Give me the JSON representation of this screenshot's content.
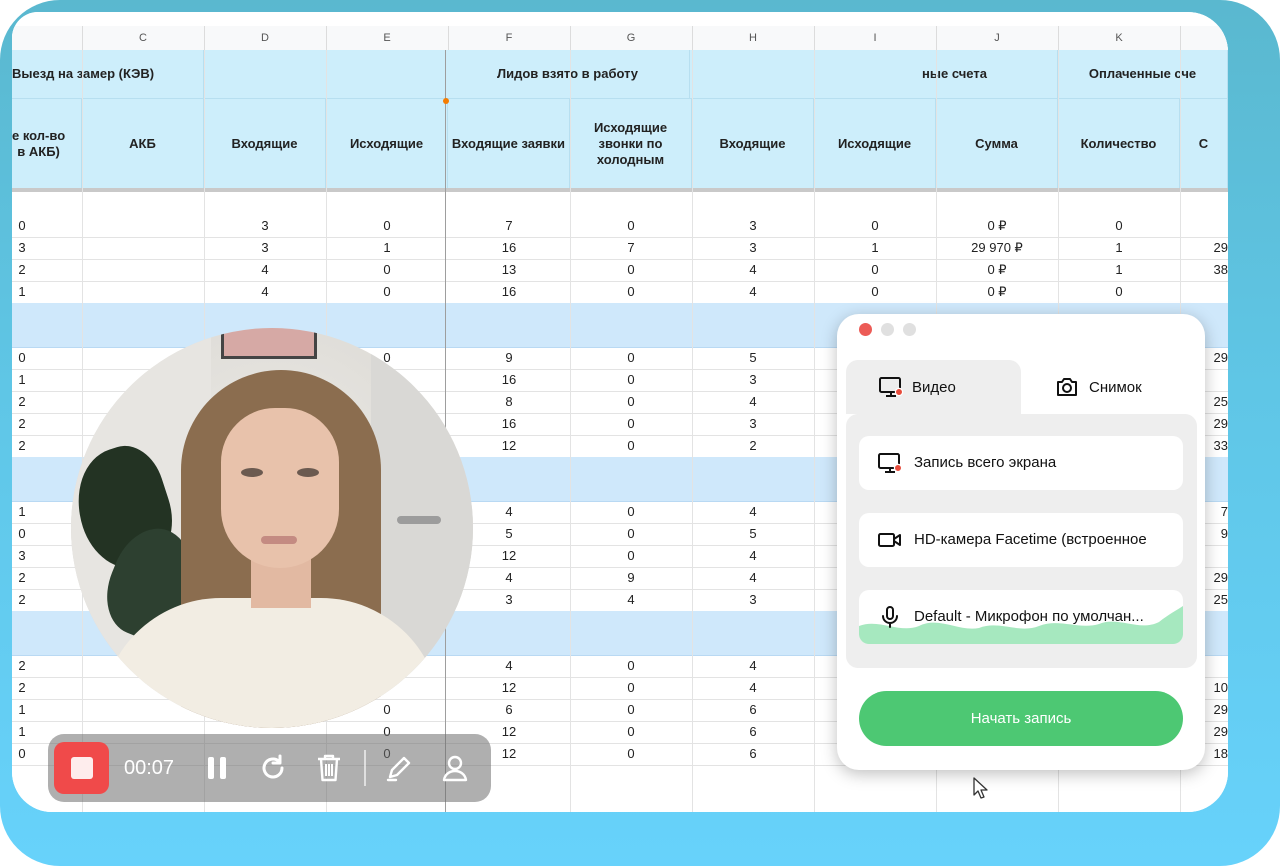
{
  "sheet": {
    "columns": [
      {
        "letter": "C",
        "width": 122
      },
      {
        "letter": "D",
        "width": 122
      },
      {
        "letter": "E",
        "width": 122
      },
      {
        "letter": "F",
        "width": 122
      },
      {
        "letter": "G",
        "width": 122
      },
      {
        "letter": "H",
        "width": 122
      },
      {
        "letter": "I",
        "width": 122
      },
      {
        "letter": "J",
        "width": 122
      },
      {
        "letter": "K",
        "width": 122
      }
    ],
    "group_headers": [
      {
        "label": "Выезд на замер (КЭВ)"
      },
      {
        "label": "Лидов взято в работу"
      },
      {
        "label": "ные счета"
      },
      {
        "label": "Оплаченные сче"
      }
    ],
    "sub_headers": [
      "е кол-во\nв АКБ)",
      "АКБ",
      "Входящие",
      "Исходящие",
      "Входящие заявки",
      "Исходящие звонки по холодным",
      "Входящие",
      "Исходящие",
      "Сумма",
      "Количество",
      "С"
    ],
    "rows": [
      {
        "blue": false,
        "cells": [
          "0",
          "",
          "3",
          "0",
          "7",
          "0",
          "3",
          "0",
          "0 ₽",
          "0",
          ""
        ]
      },
      {
        "blue": false,
        "cells": [
          "3",
          "",
          "3",
          "1",
          "16",
          "7",
          "3",
          "1",
          "29 970 ₽",
          "1",
          "29"
        ]
      },
      {
        "blue": false,
        "cells": [
          "2",
          "",
          "4",
          "0",
          "13",
          "0",
          "4",
          "0",
          "0 ₽",
          "1",
          "38"
        ]
      },
      {
        "blue": false,
        "cells": [
          "1",
          "",
          "4",
          "0",
          "16",
          "0",
          "4",
          "0",
          "0 ₽",
          "0",
          ""
        ]
      },
      {
        "blue": true,
        "cells": []
      },
      {
        "blue": true,
        "cells": []
      },
      {
        "blue": false,
        "cells": [
          "0",
          "",
          "",
          "0",
          "9",
          "0",
          "5",
          "",
          "",
          "",
          "29"
        ]
      },
      {
        "blue": false,
        "cells": [
          "1",
          "",
          "",
          "",
          "16",
          "0",
          "3",
          "",
          "",
          "",
          ""
        ]
      },
      {
        "blue": false,
        "cells": [
          "2",
          "",
          "",
          "",
          "8",
          "0",
          "4",
          "",
          "",
          "",
          "25"
        ]
      },
      {
        "blue": false,
        "cells": [
          "2",
          "",
          "",
          "",
          "16",
          "0",
          "3",
          "",
          "",
          "",
          "29"
        ]
      },
      {
        "blue": false,
        "cells": [
          "2",
          "",
          "",
          "",
          "12",
          "0",
          "2",
          "",
          "",
          "",
          "33"
        ]
      },
      {
        "blue": true,
        "cells": []
      },
      {
        "blue": true,
        "cells": []
      },
      {
        "blue": false,
        "cells": [
          "1",
          "",
          "",
          "",
          "4",
          "0",
          "4",
          "",
          "",
          "",
          "7"
        ]
      },
      {
        "blue": false,
        "cells": [
          "0",
          "",
          "",
          "",
          "5",
          "0",
          "5",
          "",
          "",
          "",
          "9"
        ]
      },
      {
        "blue": false,
        "cells": [
          "3",
          "",
          "",
          "",
          "12",
          "0",
          "4",
          "",
          "",
          "",
          ""
        ]
      },
      {
        "blue": false,
        "cells": [
          "2",
          "",
          "",
          "",
          "4",
          "9",
          "4",
          "",
          "",
          "",
          "29"
        ]
      },
      {
        "blue": false,
        "cells": [
          "2",
          "",
          "",
          "",
          "3",
          "4",
          "3",
          "",
          "",
          "",
          "25"
        ]
      },
      {
        "blue": true,
        "cells": []
      },
      {
        "blue": true,
        "cells": []
      },
      {
        "blue": false,
        "cells": [
          "2",
          "",
          "",
          "",
          "4",
          "0",
          "4",
          "",
          "",
          "",
          ""
        ]
      },
      {
        "blue": false,
        "cells": [
          "2",
          "",
          "",
          "",
          "12",
          "0",
          "4",
          "",
          "",
          "",
          "10"
        ]
      },
      {
        "blue": false,
        "cells": [
          "1",
          "",
          "",
          "0",
          "6",
          "0",
          "6",
          "",
          "",
          "",
          "29"
        ]
      },
      {
        "blue": false,
        "cells": [
          "1",
          "",
          "",
          "0",
          "12",
          "0",
          "6",
          "",
          "",
          "",
          "29"
        ]
      },
      {
        "blue": false,
        "cells": [
          "0",
          "",
          "",
          "0",
          "12",
          "0",
          "6",
          "",
          "",
          "",
          "18"
        ]
      }
    ]
  },
  "recorder_toolbar": {
    "timer": "00:07",
    "icons": [
      "stop-icon",
      "pause-icon",
      "restart-icon",
      "trash-icon",
      "pen-icon",
      "user-icon"
    ]
  },
  "recorder_panel": {
    "tabs": [
      {
        "label": "Видео",
        "icon": "monitor-record-icon",
        "active": true
      },
      {
        "label": "Снимок",
        "icon": "camera-icon",
        "active": false
      }
    ],
    "options": [
      {
        "label": "Запись всего экрана",
        "icon": "monitor-record-icon"
      },
      {
        "label": "HD-камера Facetime (встроенное",
        "icon": "video-camera-icon"
      },
      {
        "label": "Default - Микрофон по умолчан...",
        "icon": "microphone-icon"
      }
    ],
    "start_button": "Начать запись",
    "colors": {
      "start": "#4dc873",
      "stop": "#f04a4a",
      "close_dot": "#ec5b56",
      "header_band": "#cdeefb",
      "section_band": "#cfe8fb"
    }
  }
}
